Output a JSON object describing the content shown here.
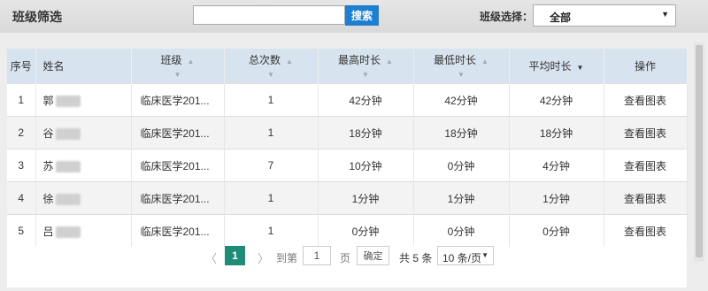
{
  "filter": {
    "title": "班级筛选",
    "search_value": "",
    "search_button": "搜索",
    "class_select_label": "班级选择：",
    "class_select_value": "全部"
  },
  "table": {
    "headers": {
      "index": "序号",
      "name": "姓名",
      "class": "班级",
      "total_count": "总次数",
      "max_duration": "最高时长",
      "min_duration": "最低时长",
      "avg_duration": "平均时长",
      "action": "操作"
    },
    "rows": [
      {
        "index": "1",
        "name": "郭",
        "class": "临床医学201...",
        "total_count": "1",
        "max_duration": "42分钟",
        "min_duration": "42分钟",
        "avg_duration": "42分钟",
        "action": "查看图表"
      },
      {
        "index": "2",
        "name": "谷",
        "class": "临床医学201...",
        "total_count": "1",
        "max_duration": "18分钟",
        "min_duration": "18分钟",
        "avg_duration": "18分钟",
        "action": "查看图表"
      },
      {
        "index": "3",
        "name": "苏",
        "class": "临床医学201...",
        "total_count": "7",
        "max_duration": "10分钟",
        "min_duration": "0分钟",
        "avg_duration": "4分钟",
        "action": "查看图表"
      },
      {
        "index": "4",
        "name": "徐",
        "class": "临床医学201...",
        "total_count": "1",
        "max_duration": "1分钟",
        "min_duration": "1分钟",
        "avg_duration": "1分钟",
        "action": "查看图表"
      },
      {
        "index": "5",
        "name": "吕",
        "class": "临床医学201...",
        "total_count": "1",
        "max_duration": "0分钟",
        "min_duration": "0分钟",
        "avg_duration": "0分钟",
        "action": "查看图表"
      }
    ]
  },
  "pagination": {
    "prev_icon": "chevron-left-icon",
    "current_page": "1",
    "next_icon": "chevron-right-icon",
    "goto_label": "到第",
    "goto_value": "1",
    "page_unit": "页",
    "confirm_button": "确定",
    "total_label": "共 5 条",
    "page_size": "10 条/页"
  },
  "colors": {
    "accent": "#1e7fd0",
    "page_active": "#1f8c78",
    "header_bg": "#d7e3ee"
  }
}
